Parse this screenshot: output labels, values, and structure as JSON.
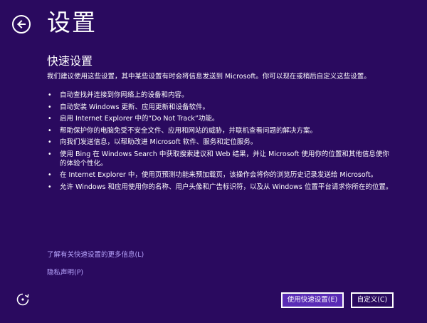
{
  "header": {
    "title": "设置"
  },
  "section": {
    "title": "快速设置",
    "intro": "我们建议使用这些设置，其中某些设置有时会将信息发送到 Microsoft。你可以现在或稍后自定义这些设置。",
    "bullets": [
      "自动查找并连接到你网络上的设备和内容。",
      "自动安装 Windows 更新、应用更新和设备软件。",
      "启用 Internet Explorer 中的“Do Not Track”功能。",
      "帮助保护你的电脑免受不安全文件、应用和网站的威胁，并联机查看问题的解决方案。",
      "向我们发送信息，以帮助改进 Microsoft 软件、服务和定位服务。",
      "使用 Bing 在 Windows Search 中获取搜索建议和 Web 结果，并让 Microsoft 使用你的位置和其他信息使你的体验个性化。",
      "在 Internet Explorer 中，使用页预测功能来预加载页，该操作会将你的浏览历史记录发送给 Microsoft。",
      "允许 Windows 和应用使用你的名称、用户头像和广告标识符，以及从 Windows 位置平台请求你所在的位置。"
    ]
  },
  "links": {
    "more_info": "了解有关快速设置的更多信息(L)",
    "privacy": "隐私声明(P)"
  },
  "buttons": {
    "express": "使用快速设置(E)",
    "customize": "自定义(C)"
  },
  "colors": {
    "background": "#2a0a5f",
    "accent": "#5a2bb5",
    "link": "#b9a6ff"
  },
  "icons": {
    "back": "arrow-left-circle-icon",
    "accessibility": "ease-of-access-icon"
  }
}
